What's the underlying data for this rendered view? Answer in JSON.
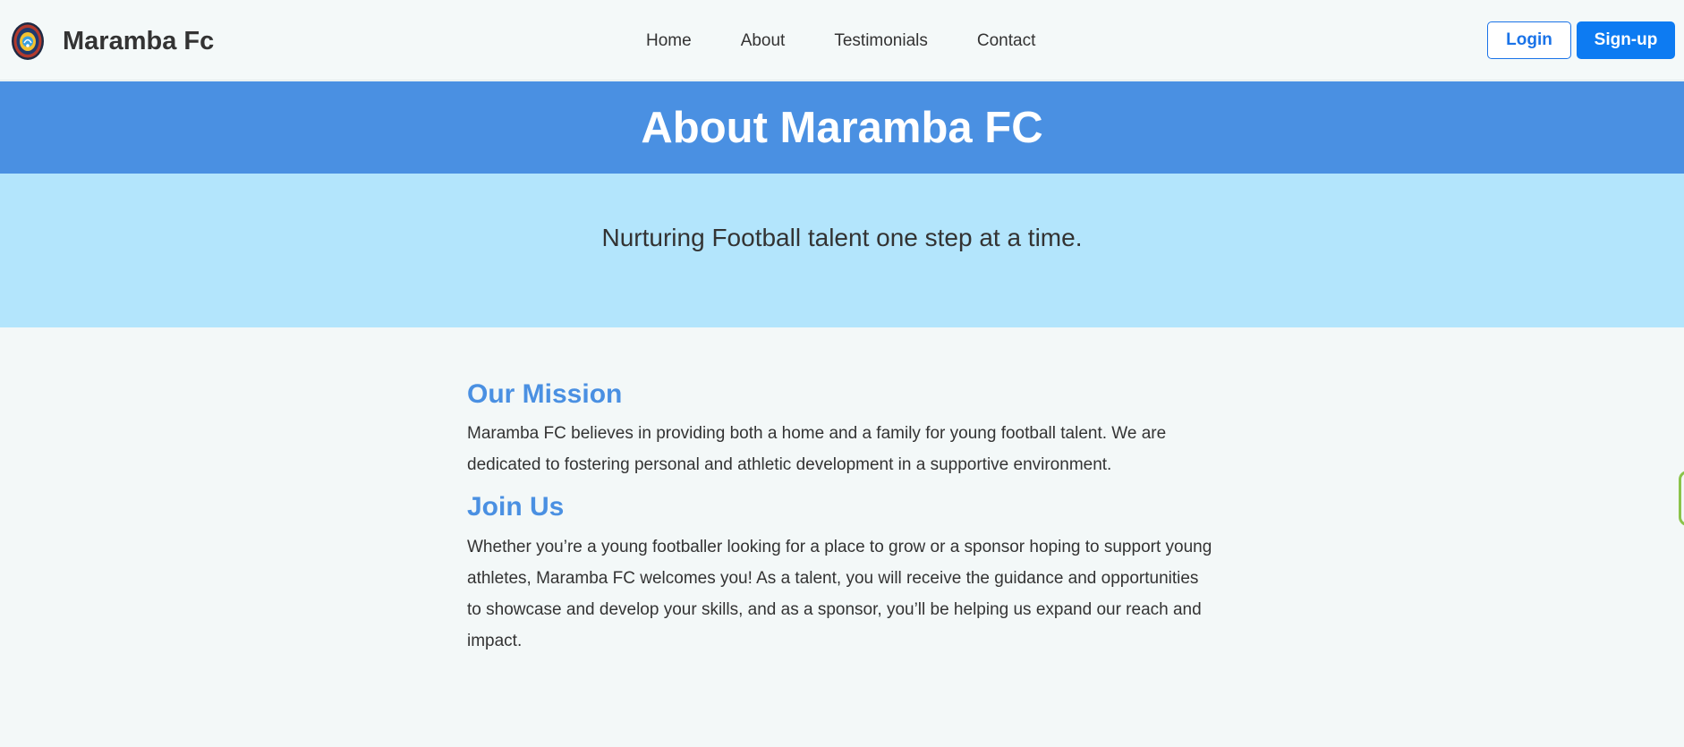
{
  "header": {
    "brand_name": "Maramba Fc",
    "logo_icon": "club-crest-logo",
    "nav": [
      {
        "label": "Home"
      },
      {
        "label": "About"
      },
      {
        "label": "Testimonials"
      },
      {
        "label": "Contact"
      }
    ],
    "login_label": "Login",
    "signup_label": "Sign-up"
  },
  "banner": {
    "title": "About Maramba FC"
  },
  "hero": {
    "tagline": "Nurturing Football talent one step at a time."
  },
  "main": {
    "mission": {
      "heading": "Our Mission",
      "text": "Maramba FC believes in providing both a home and a family for young football talent. We are dedicated to fostering personal and athletic development in a supportive environment."
    },
    "join": {
      "heading": "Join Us",
      "text": "Whether you’re a young footballer looking for a place to grow or a sponsor hoping to support young athletes, Maramba FC welcomes you! As a talent, you will receive the guidance and opportunities to showcase and develop your skills, and as a sponsor, you’ll be helping us expand our reach and impact."
    }
  },
  "colors": {
    "primary_blue": "#4a90e2",
    "button_blue": "#0d7bf2",
    "tagline_bg": "#b3e5fc",
    "page_bg": "#f3f8f8",
    "edge_tab_green": "#8bc34a"
  }
}
